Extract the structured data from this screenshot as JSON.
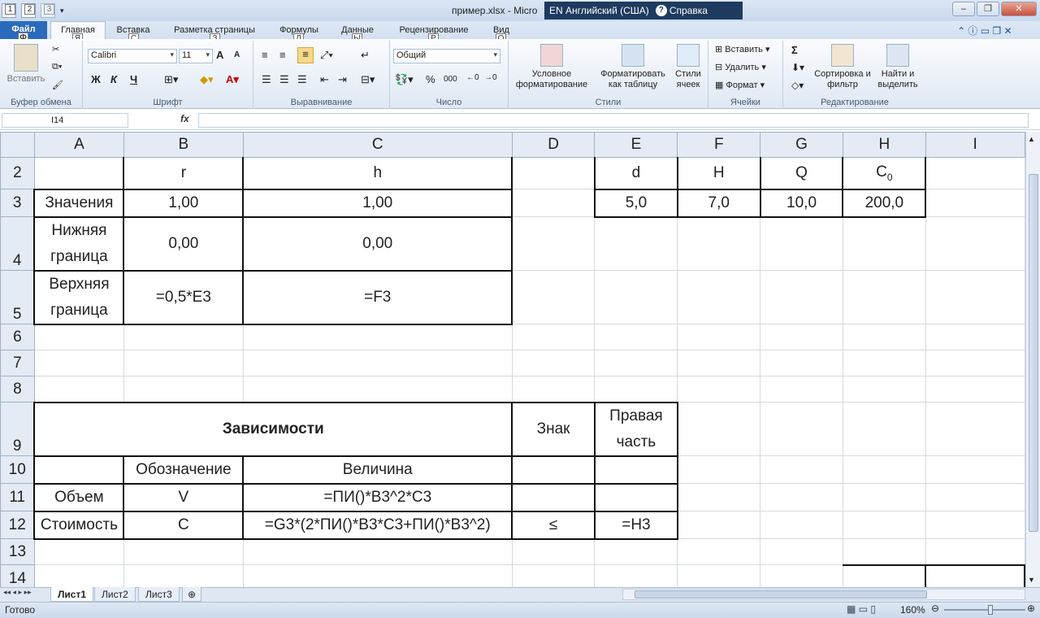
{
  "window": {
    "title": "пример.xlsx  -  Micro",
    "lang": "EN Английский (США)",
    "help": "Справка"
  },
  "qat": {
    "keytips": [
      "1",
      "2",
      "3"
    ]
  },
  "tabs": {
    "file": "Файл",
    "home": "Главная",
    "insert": "Вставка",
    "layout": "Разметка страницы",
    "formulas": "Формулы",
    "data": "Данные",
    "review": "Рецензирование",
    "view": "Вид",
    "keytips": {
      "file": "Ф",
      "home": "Я",
      "insert": "С",
      "layout": "З",
      "formulas": "Л",
      "data": "Ы",
      "review": "Р",
      "view": "О"
    }
  },
  "ribbon": {
    "clipboard": {
      "paste": "Вставить",
      "label": "Буфер обмена"
    },
    "font": {
      "name": "Calibri",
      "size": "11",
      "bold": "Ж",
      "italic": "К",
      "underline": "Ч",
      "grow": "A",
      "shrink": "A",
      "label": "Шрифт"
    },
    "alignment": {
      "label": "Выравнивание"
    },
    "number": {
      "format": "Общий",
      "percent": "%",
      "thousands": "000",
      "label": "Число"
    },
    "styles": {
      "conditional": "Условное форматирование",
      "as_table": "Форматировать как таблицу",
      "cell_styles": "Стили ячеек",
      "label": "Стили"
    },
    "cells": {
      "insert": "Вставить",
      "delete": "Удалить",
      "format": "Формат",
      "label": "Ячейки"
    },
    "editing": {
      "sigma": "Σ",
      "sort": "Сортировка и фильтр",
      "find": "Найти и выделить",
      "label": "Редактирование"
    }
  },
  "formula_bar": {
    "name_box": "I14",
    "fx": "fx",
    "formula": ""
  },
  "sheet": {
    "columns": [
      "A",
      "B",
      "C",
      "D",
      "E",
      "F",
      "G",
      "H",
      "I"
    ],
    "rows": [
      {
        "n": "2",
        "A": "",
        "B": "r",
        "C": "h",
        "D": "",
        "E": "d",
        "F": "H",
        "G": "Q",
        "H": "C0"
      },
      {
        "n": "3",
        "A": "Значения",
        "B": "1,00",
        "C": "1,00",
        "D": "",
        "E": "5,0",
        "F": "7,0",
        "G": "10,0",
        "H": "200,0"
      },
      {
        "n": "4",
        "A": "Нижняя граница",
        "B": "0,00",
        "C": "0,00"
      },
      {
        "n": "5",
        "A": "Верхняя граница",
        "B": "=0,5*E3",
        "C": "=F3"
      },
      {
        "n": "6"
      },
      {
        "n": "7"
      },
      {
        "n": "8"
      },
      {
        "n": "9",
        "AC": "Зависимости",
        "D": "Знак",
        "E": "Правая часть"
      },
      {
        "n": "10",
        "A": "",
        "B": "Обозначение",
        "C": "Величина",
        "D": "",
        "E": ""
      },
      {
        "n": "11",
        "A": "Объем",
        "B": "V",
        "C": "=ПИ()*B3^2*C3",
        "D": "",
        "E": ""
      },
      {
        "n": "12",
        "A": "Стоимость",
        "B": "C",
        "C": "=G3*(2*ПИ()*B3*C3+ПИ()*B3^2)",
        "D": "≤",
        "E": "=H3"
      },
      {
        "n": "13"
      },
      {
        "n": "14"
      }
    ]
  },
  "sheet_tabs": [
    "Лист1",
    "Лист2",
    "Лист3"
  ],
  "status": {
    "ready": "Готово",
    "zoom": "160%"
  }
}
